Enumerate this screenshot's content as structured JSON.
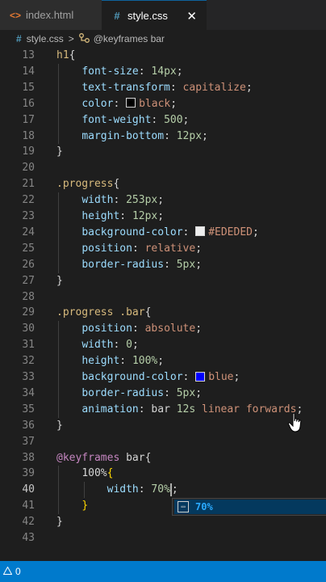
{
  "tabs": [
    {
      "icon": "<>",
      "label": "index.html"
    },
    {
      "icon": "#",
      "label": "style.css",
      "close": "✕"
    }
  ],
  "breadcrumb": {
    "file_icon": "#",
    "file": "style.css",
    "separator": ">",
    "symbol_icon": "keyframes-icon",
    "symbol": "@keyframes bar"
  },
  "lines": [
    {
      "n": "13",
      "tokens": [
        {
          "t": "h1",
          "c": "sel"
        },
        {
          "t": "{",
          "c": "brace"
        }
      ]
    },
    {
      "n": "14",
      "tokens": [
        {
          "t": "    "
        },
        {
          "t": "font-size",
          "c": "prop"
        },
        {
          "t": ": ",
          "c": "pun"
        },
        {
          "t": "14px",
          "c": "num"
        },
        {
          "t": ";",
          "c": "pun"
        }
      ]
    },
    {
      "n": "15",
      "tokens": [
        {
          "t": "    "
        },
        {
          "t": "text-transform",
          "c": "prop"
        },
        {
          "t": ": ",
          "c": "pun"
        },
        {
          "t": "capitalize",
          "c": "val"
        },
        {
          "t": ";",
          "c": "pun"
        }
      ]
    },
    {
      "n": "16",
      "tokens": [
        {
          "t": "    "
        },
        {
          "t": "color",
          "c": "prop"
        },
        {
          "t": ": ",
          "c": "pun"
        },
        {
          "swatch": "#000000"
        },
        {
          "t": "black",
          "c": "val"
        },
        {
          "t": ";",
          "c": "pun"
        }
      ]
    },
    {
      "n": "17",
      "tokens": [
        {
          "t": "    "
        },
        {
          "t": "font-weight",
          "c": "prop"
        },
        {
          "t": ": ",
          "c": "pun"
        },
        {
          "t": "500",
          "c": "num"
        },
        {
          "t": ";",
          "c": "pun"
        }
      ]
    },
    {
      "n": "18",
      "tokens": [
        {
          "t": "    "
        },
        {
          "t": "margin-bottom",
          "c": "prop"
        },
        {
          "t": ": ",
          "c": "pun"
        },
        {
          "t": "12px",
          "c": "num"
        },
        {
          "t": ";",
          "c": "pun"
        }
      ]
    },
    {
      "n": "19",
      "tokens": [
        {
          "t": "}",
          "c": "brace"
        }
      ]
    },
    {
      "n": "20",
      "tokens": []
    },
    {
      "n": "21",
      "tokens": [
        {
          "t": ".progress",
          "c": "sel"
        },
        {
          "t": "{",
          "c": "brace"
        }
      ]
    },
    {
      "n": "22",
      "tokens": [
        {
          "t": "    "
        },
        {
          "t": "width",
          "c": "prop"
        },
        {
          "t": ": ",
          "c": "pun"
        },
        {
          "t": "253px",
          "c": "num"
        },
        {
          "t": ";",
          "c": "pun"
        }
      ]
    },
    {
      "n": "23",
      "tokens": [
        {
          "t": "    "
        },
        {
          "t": "height",
          "c": "prop"
        },
        {
          "t": ": ",
          "c": "pun"
        },
        {
          "t": "12px",
          "c": "num"
        },
        {
          "t": ";",
          "c": "pun"
        }
      ]
    },
    {
      "n": "24",
      "tokens": [
        {
          "t": "    "
        },
        {
          "t": "background-color",
          "c": "prop"
        },
        {
          "t": ": ",
          "c": "pun"
        },
        {
          "swatch": "#EDEDED"
        },
        {
          "t": "#EDEDED",
          "c": "val"
        },
        {
          "t": ";",
          "c": "pun"
        }
      ]
    },
    {
      "n": "25",
      "tokens": [
        {
          "t": "    "
        },
        {
          "t": "position",
          "c": "prop"
        },
        {
          "t": ": ",
          "c": "pun"
        },
        {
          "t": "relative",
          "c": "val"
        },
        {
          "t": ";",
          "c": "pun"
        }
      ]
    },
    {
      "n": "26",
      "tokens": [
        {
          "t": "    "
        },
        {
          "t": "border-radius",
          "c": "prop"
        },
        {
          "t": ": ",
          "c": "pun"
        },
        {
          "t": "5px",
          "c": "num"
        },
        {
          "t": ";",
          "c": "pun"
        }
      ]
    },
    {
      "n": "27",
      "tokens": [
        {
          "t": "}",
          "c": "brace"
        }
      ]
    },
    {
      "n": "28",
      "tokens": []
    },
    {
      "n": "29",
      "tokens": [
        {
          "t": ".progress .bar",
          "c": "sel"
        },
        {
          "t": "{",
          "c": "brace"
        }
      ]
    },
    {
      "n": "30",
      "tokens": [
        {
          "t": "    "
        },
        {
          "t": "position",
          "c": "prop"
        },
        {
          "t": ": ",
          "c": "pun"
        },
        {
          "t": "absolute",
          "c": "val"
        },
        {
          "t": ";",
          "c": "pun"
        }
      ]
    },
    {
      "n": "31",
      "tokens": [
        {
          "t": "    "
        },
        {
          "t": "width",
          "c": "prop"
        },
        {
          "t": ": ",
          "c": "pun"
        },
        {
          "t": "0",
          "c": "num"
        },
        {
          "t": ";",
          "c": "pun"
        }
      ]
    },
    {
      "n": "32",
      "tokens": [
        {
          "t": "    "
        },
        {
          "t": "height",
          "c": "prop"
        },
        {
          "t": ": ",
          "c": "pun"
        },
        {
          "t": "100%",
          "c": "num"
        },
        {
          "t": ";",
          "c": "pun"
        }
      ]
    },
    {
      "n": "33",
      "tokens": [
        {
          "t": "    "
        },
        {
          "t": "background-color",
          "c": "prop"
        },
        {
          "t": ": ",
          "c": "pun"
        },
        {
          "swatch": "#0000ff"
        },
        {
          "t": "blue",
          "c": "val"
        },
        {
          "t": ";",
          "c": "pun"
        }
      ]
    },
    {
      "n": "34",
      "tokens": [
        {
          "t": "    "
        },
        {
          "t": "border-radius",
          "c": "prop"
        },
        {
          "t": ": ",
          "c": "pun"
        },
        {
          "t": "5px",
          "c": "num"
        },
        {
          "t": ";",
          "c": "pun"
        }
      ]
    },
    {
      "n": "35",
      "tokens": [
        {
          "t": "    "
        },
        {
          "t": "animation",
          "c": "prop"
        },
        {
          "t": ": ",
          "c": "pun"
        },
        {
          "t": "bar ",
          "c": "pun"
        },
        {
          "t": "12s",
          "c": "num"
        },
        {
          "t": " linear forwards",
          "c": "val"
        },
        {
          "t": ";",
          "c": "pun"
        }
      ]
    },
    {
      "n": "36",
      "tokens": [
        {
          "t": "}",
          "c": "brace"
        }
      ]
    },
    {
      "n": "37",
      "tokens": []
    },
    {
      "n": "38",
      "tokens": [
        {
          "t": "@keyframes",
          "c": "kw"
        },
        {
          "t": " bar",
          "c": "pun"
        },
        {
          "t": "{",
          "c": "brace"
        }
      ]
    },
    {
      "n": "39",
      "tokens": [
        {
          "t": "    "
        },
        {
          "t": "100%",
          "c": "pun"
        },
        {
          "t": "{",
          "c": "brace-y"
        }
      ]
    },
    {
      "n": "40",
      "tokens": [
        {
          "t": "        "
        },
        {
          "t": "width",
          "c": "prop"
        },
        {
          "t": ": ",
          "c": "pun"
        },
        {
          "t": "70%",
          "c": "num"
        },
        {
          "cursor": true
        },
        {
          "t": ";",
          "c": "pun"
        }
      ],
      "active": true
    },
    {
      "n": "41",
      "tokens": [
        {
          "t": "    "
        },
        {
          "t": "}",
          "c": "brace-y"
        }
      ]
    },
    {
      "n": "42",
      "tokens": [
        {
          "t": "}",
          "c": "brace"
        }
      ]
    },
    {
      "n": "43",
      "tokens": []
    }
  ],
  "suggestion": {
    "icon": "value-icon",
    "text": "70%"
  },
  "status": {
    "icon": "warning-icon",
    "text": "0"
  }
}
